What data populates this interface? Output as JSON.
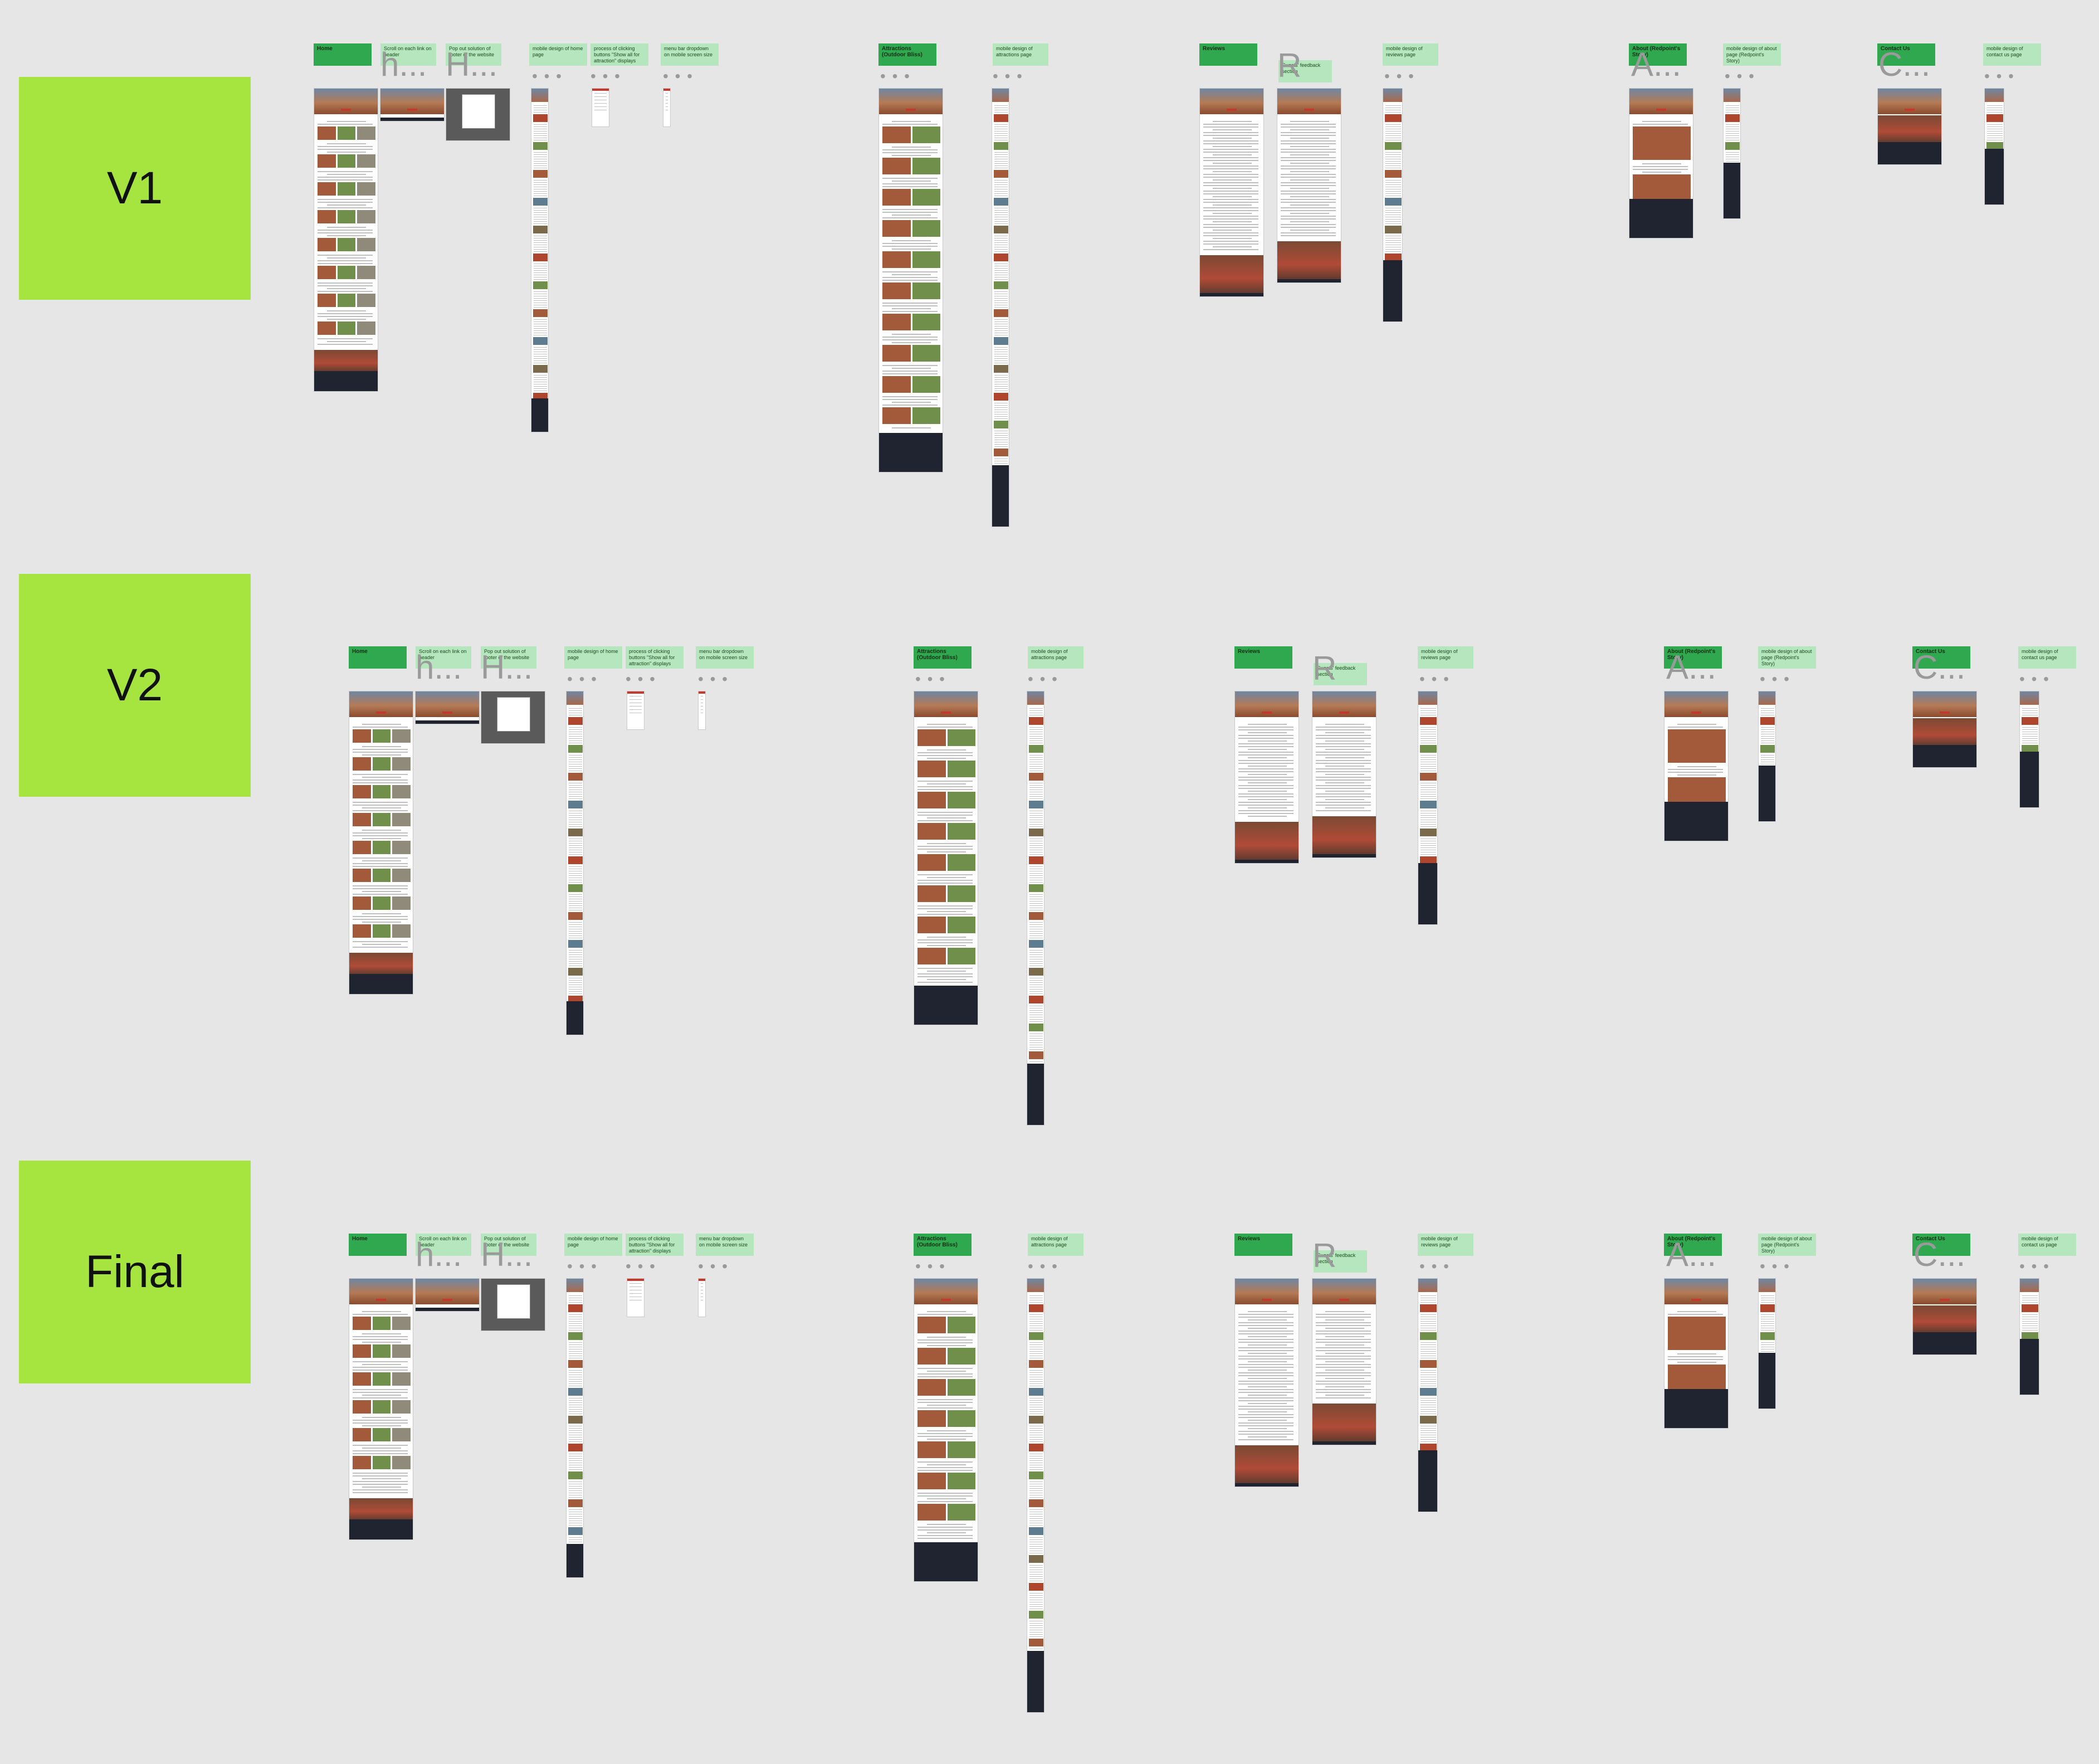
{
  "rows": [
    {
      "label": "V1",
      "stickies": {
        "home": "Home",
        "home_n1": "Scroll on each link on header",
        "home_n2": "Pop out solution of footer of the website",
        "home_mobile": "mobile design of home page",
        "home_n4": "process of clicking buttons \"Show all for attraction\" displays",
        "home_n5": "menu bar dropdown on mobile screen size",
        "attractions": "Attractions (Outdoor Bliss)",
        "attractions_mobile": "mobile design of attractions page",
        "reviews": "Reviews",
        "reviews_n1": "Guests' feedback section",
        "reviews_mobile": "mobile design of reviews page",
        "about": "About (Redpoint's Story)",
        "about_mobile": "mobile design of about page (Redpoint's Story)",
        "contact": "Contact Us",
        "contact_mobile": "mobile design of contact us page"
      }
    },
    {
      "label": "V2",
      "stickies": {
        "home": "Home",
        "home_n1": "Scroll on each link on header",
        "home_n2": "Pop out solution of footer of the website",
        "home_mobile": "mobile design of home page",
        "home_n4": "process of clicking buttons \"Show all for attraction\" displays",
        "home_n5": "menu bar dropdown on mobile screen size",
        "attractions": "Attractions (Outdoor Bliss)",
        "attractions_mobile": "mobile design of attractions page",
        "reviews": "Reviews",
        "reviews_n1": "Guests' feedback section",
        "reviews_mobile": "mobile design of reviews page",
        "about": "About (Redpoint's Story)",
        "about_mobile": "mobile design of about page (Redpoint's Story)",
        "contact": "Contact Us",
        "contact_mobile": "mobile design of contact us page"
      }
    },
    {
      "label": "Final",
      "stickies": {
        "home": "Home",
        "home_n1": "Scroll on each link on header",
        "home_n2": "Pop out solution of footer of the website",
        "home_mobile": "mobile design of home page",
        "home_n4": "process of clicking buttons \"Show all for attraction\" displays",
        "home_n5": "menu bar dropdown on mobile screen size",
        "attractions": "Attractions (Outdoor Bliss)",
        "attractions_mobile": "mobile design of attractions page",
        "reviews": "Reviews",
        "reviews_n1": "Guests' feedback section",
        "reviews_mobile": "mobile design of reviews page",
        "about": "About (Redpoint's Story)",
        "about_mobile": "mobile design of about page (Redpoint's Story)",
        "contact": "Contact Us",
        "contact_mobile": "mobile design of contact us page"
      }
    }
  ],
  "ghosts": {
    "h": "h...",
    "H": "H...",
    "A": "A...",
    "R": "R",
    "C": "C...",
    "dots": "• • •"
  },
  "colors": {
    "background": "#e6e6e6",
    "row_label": "#a6e43f",
    "sticky_dark": "#2fa84f",
    "sticky_light": "#b6e6bd",
    "hero_red": "#b33b2a",
    "footer_dark": "#1f2430"
  }
}
